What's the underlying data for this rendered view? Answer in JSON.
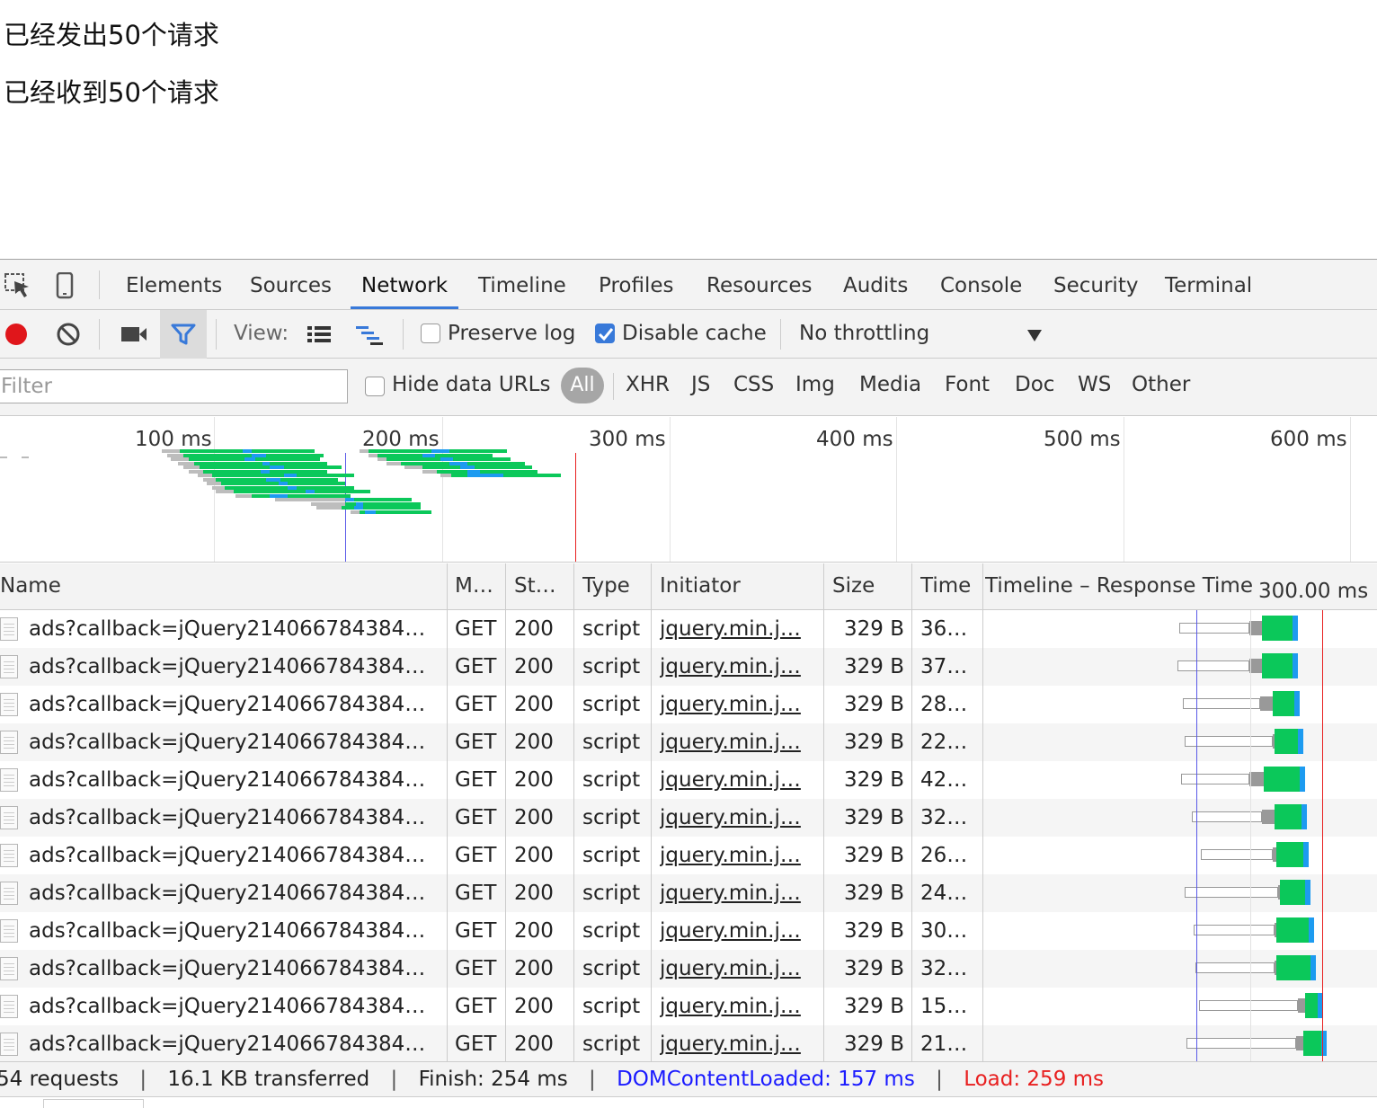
{
  "page": {
    "line1": "已经发出50个请求",
    "line2": "已经收到50个请求"
  },
  "tabs": [
    "Elements",
    "Sources",
    "Network",
    "Timeline",
    "Profiles",
    "Resources",
    "Audits",
    "Console",
    "Security",
    "Terminal"
  ],
  "active_tab": "Network",
  "toolbar": {
    "view_label": "View:",
    "preserve_log_label": "Preserve log",
    "preserve_log_checked": false,
    "disable_cache_label": "Disable cache",
    "disable_cache_checked": true,
    "throttling": "No throttling"
  },
  "filter": {
    "placeholder": "Filter",
    "hide_data_urls_label": "Hide data URLs",
    "types": [
      "All",
      "XHR",
      "JS",
      "CSS",
      "Img",
      "Media",
      "Font",
      "Doc",
      "WS",
      "Other"
    ]
  },
  "overview": {
    "ticks": [
      "100 ms",
      "200 ms",
      "300 ms",
      "400 ms",
      "500 ms",
      "600 ms"
    ]
  },
  "table": {
    "headers": {
      "name": "Name",
      "method": "M…",
      "status": "St…",
      "type": "Type",
      "initiator": "Initiator",
      "size": "Size",
      "time": "Time",
      "timeline": "Timeline – Response Time",
      "timeline_scale": "300.00 ms"
    },
    "rows": [
      {
        "name": "ads?callback=jQuery214066784384…",
        "method": "GET",
        "status": "200",
        "type": "script",
        "initiator": "jquery.min.j…",
        "size": "329 B",
        "time": "36…"
      },
      {
        "name": "ads?callback=jQuery214066784384…",
        "method": "GET",
        "status": "200",
        "type": "script",
        "initiator": "jquery.min.j…",
        "size": "329 B",
        "time": "37…"
      },
      {
        "name": "ads?callback=jQuery214066784384…",
        "method": "GET",
        "status": "200",
        "type": "script",
        "initiator": "jquery.min.j…",
        "size": "329 B",
        "time": "28…"
      },
      {
        "name": "ads?callback=jQuery214066784384…",
        "method": "GET",
        "status": "200",
        "type": "script",
        "initiator": "jquery.min.j…",
        "size": "329 B",
        "time": "22…"
      },
      {
        "name": "ads?callback=jQuery214066784384…",
        "method": "GET",
        "status": "200",
        "type": "script",
        "initiator": "jquery.min.j…",
        "size": "329 B",
        "time": "42…"
      },
      {
        "name": "ads?callback=jQuery214066784384…",
        "method": "GET",
        "status": "200",
        "type": "script",
        "initiator": "jquery.min.j…",
        "size": "329 B",
        "time": "32…"
      },
      {
        "name": "ads?callback=jQuery214066784384…",
        "method": "GET",
        "status": "200",
        "type": "script",
        "initiator": "jquery.min.j…",
        "size": "329 B",
        "time": "26…"
      },
      {
        "name": "ads?callback=jQuery214066784384…",
        "method": "GET",
        "status": "200",
        "type": "script",
        "initiator": "jquery.min.j…",
        "size": "329 B",
        "time": "24…"
      },
      {
        "name": "ads?callback=jQuery214066784384…",
        "method": "GET",
        "status": "200",
        "type": "script",
        "initiator": "jquery.min.j…",
        "size": "329 B",
        "time": "30…"
      },
      {
        "name": "ads?callback=jQuery214066784384…",
        "method": "GET",
        "status": "200",
        "type": "script",
        "initiator": "jquery.min.j…",
        "size": "329 B",
        "time": "32…"
      },
      {
        "name": "ads?callback=jQuery214066784384…",
        "method": "GET",
        "status": "200",
        "type": "script",
        "initiator": "jquery.min.j…",
        "size": "329 B",
        "time": "15…"
      },
      {
        "name": "ads?callback=jQuery214066784384…",
        "method": "GET",
        "status": "200",
        "type": "script",
        "initiator": "jquery.min.j…",
        "size": "329 B",
        "time": "21…"
      }
    ]
  },
  "status_bar": {
    "requests": "54 requests",
    "transferred": "16.1 KB transferred",
    "finish": "Finish: 254 ms",
    "dom_content_loaded": "DOMContentLoaded: 157 ms",
    "load": "Load: 259 ms",
    "separator": "|"
  },
  "colors": {
    "accent": "#3879d9",
    "dcl": "#1a1aff",
    "load": "#e82020",
    "receive": "#0bc85a",
    "download": "#1d9bf0",
    "record": "#e0161b"
  }
}
